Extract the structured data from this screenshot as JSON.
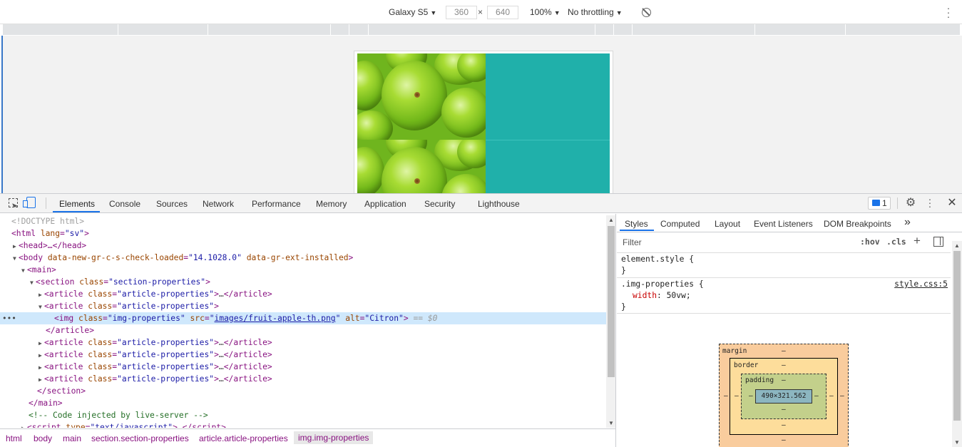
{
  "device_toolbar": {
    "device": "Galaxy S5",
    "width": "360",
    "x_sep": "×",
    "height": "640",
    "zoom": "100%",
    "throttle": "No throttling"
  },
  "devtools": {
    "tabs": [
      "Elements",
      "Console",
      "Sources",
      "Network",
      "Performance",
      "Memory",
      "Application",
      "Security",
      "Lighthouse"
    ],
    "issues_count": "1",
    "close": "✕"
  },
  "dom": {
    "doctype": "<!DOCTYPE html>",
    "html_open": "<html",
    "html_attr": "lang",
    "html_val": "\"sv\"",
    "head": "<head>…</head>",
    "body_attr1": "data-new-gr-c-s-check-loaded",
    "body_val1": "\"14.1028.0\"",
    "body_attr2": "data-gr-ext-installed",
    "main": "<main>",
    "section_class": "\"section-properties\"",
    "article_class": "\"article-properties\"",
    "img_class": "\"img-properties\"",
    "img_src": "images/fruit-apple-th.png",
    "img_alt": "\"Citron\"",
    "sel_marker": "== $0",
    "article_close": "</article>",
    "section_close": "</section>",
    "main_close": "</main>",
    "comment": "<!-- Code injected by live-server -->",
    "script_type": "\"text/javascript\"",
    "dots": "•••"
  },
  "breadcrumbs": [
    "html",
    "body",
    "main",
    "section.section-properties",
    "article.article-properties",
    "img.img-properties"
  ],
  "styles": {
    "tabs": [
      "Styles",
      "Computed",
      "Layout",
      "Event Listeners",
      "DOM Breakpoints"
    ],
    "overflow": "»",
    "filter_placeholder": "Filter",
    "hov": ":hov",
    "cls": ".cls",
    "element_style": "element.style {",
    "close_brace": "}",
    "rule_selector": ".img-properties {",
    "rule_source": "style.css:5",
    "prop_name": "width",
    "prop_value": "50vw;"
  },
  "box_model": {
    "margin_label": "margin",
    "border_label": "border",
    "padding_label": "padding",
    "content": "490×321.562",
    "dash": "–"
  },
  "colors": {
    "accent": "#1a73e8",
    "teal": "#20b0aa",
    "tag": "#881280",
    "attr": "#994500",
    "value": "#1a1aa6"
  }
}
